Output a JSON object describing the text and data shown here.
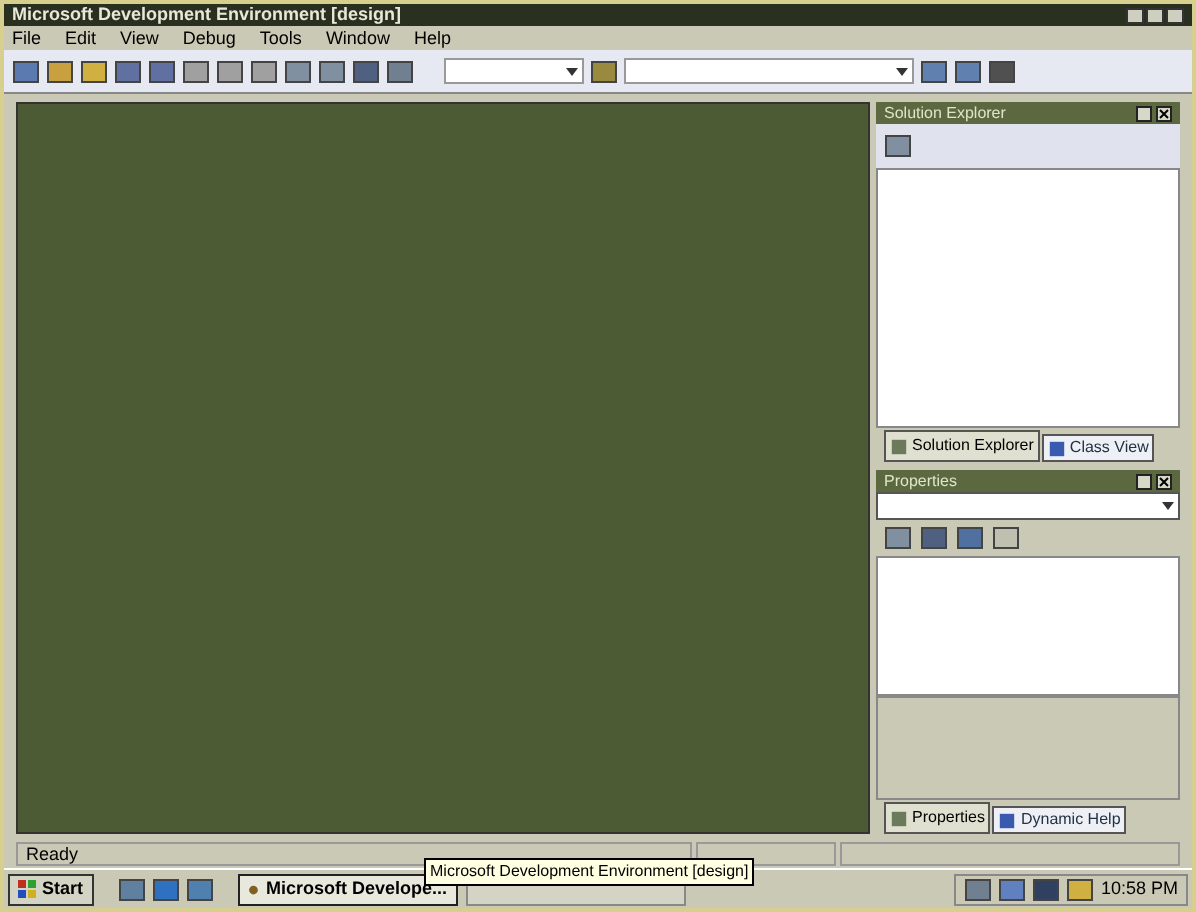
{
  "window": {
    "title": "Microsoft Development Environment [design]"
  },
  "menu": [
    "File",
    "Edit",
    "View",
    "Debug",
    "Tools",
    "Window",
    "Help"
  ],
  "solution_explorer": {
    "title": "Solution Explorer",
    "tabs": [
      {
        "label": "Solution Explorer",
        "selected": true
      },
      {
        "label": "Class View",
        "selected": false
      }
    ]
  },
  "properties": {
    "title": "Properties",
    "tabs": [
      {
        "label": "Properties",
        "selected": true
      },
      {
        "label": "Dynamic Help",
        "selected": false
      }
    ]
  },
  "status_bar": {
    "text": "Ready"
  },
  "taskbar": {
    "start": "Start",
    "buttons": [
      {
        "label": "Microsoft Develope...",
        "selected": true
      }
    ],
    "tooltip": "Microsoft Development Environment [design]",
    "clock": "10:58 PM"
  }
}
